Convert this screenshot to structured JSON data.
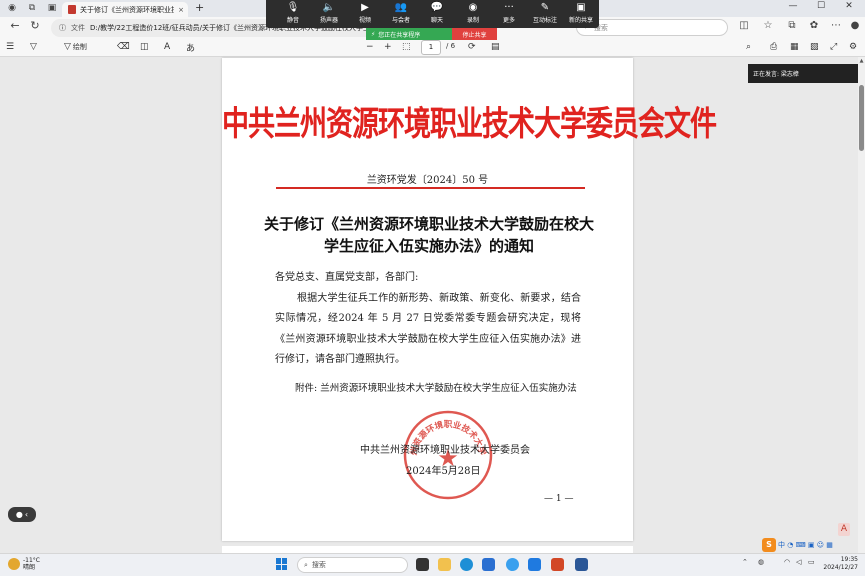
{
  "browser": {
    "tab_title": "关于修订《兰州资源环境职业技术",
    "tab_close": "×",
    "new_tab": "+",
    "omnibox_label": "文件",
    "url": "D:/教学/22工程造价12班/征兵动员/关于修订《兰州资源环境职业技术大学鼓励在校大学生应征入伍实施办法》的通知.pdf",
    "search_placeholder": "搜索"
  },
  "meeting": {
    "items": [
      {
        "label": "静音",
        "icon": "mic-icon"
      },
      {
        "label": "扬声器",
        "icon": "speaker-icon"
      },
      {
        "label": "视频",
        "icon": "camera-icon"
      },
      {
        "label": "与会者",
        "icon": "participants-icon"
      },
      {
        "label": "聊天",
        "icon": "chat-icon"
      },
      {
        "label": "录制",
        "icon": "record-icon"
      },
      {
        "label": "更多",
        "icon": "more-icon"
      },
      {
        "label": "互动标注",
        "icon": "annotate-icon"
      },
      {
        "label": "新的共享",
        "icon": "new-share-icon"
      }
    ],
    "share_status": "您正在共享程序",
    "stop_share": "停止共享",
    "presenter": "正在发言: 梁志樟"
  },
  "pdf_toolbar": {
    "draw_label": "绘制",
    "current_page": "1",
    "total_pages": "/ 6",
    "zoom_out": "−",
    "zoom_in": "+"
  },
  "document": {
    "header": "中共兰州资源环境职业技术大学委员会文件",
    "doc_number": "兰资环党发〔2024〕50 号",
    "title": "关于修订《兰州资源环境职业技术大学鼓励在校大学生应征入伍实施办法》的通知",
    "salutation": "各党总支、直属党支部，各部门:",
    "body": "根据大学生征兵工作的新形势、新政策、新变化、新要求，结合实际情况，经2024 年 5 月 27 日党委常委专题会研究决定，现将《兰州资源环境职业技术大学鼓励在校大学生应征入伍实施办法》进行修订，请各部门遵照执行。",
    "attachment": "附件: 兰州资源环境职业技术大学鼓励在校大学生应征入伍实施办法",
    "signer": "中共兰州资源环境职业技术大学委员会",
    "date": "2024年5月28日",
    "page_number": "— 1 —",
    "seal_text": "中共兰州资源环境职业技术大学委员会"
  },
  "taskbar": {
    "weather_temp": "-11°C",
    "weather_desc": "晴朗",
    "search_placeholder": "搜索",
    "time": "19:35",
    "date": "2024/12/27",
    "ime_label": "S",
    "ime_mode": "中"
  },
  "colors": {
    "header_red": "#e0231f",
    "share_green": "#35a853",
    "stop_red": "#e0413e"
  }
}
